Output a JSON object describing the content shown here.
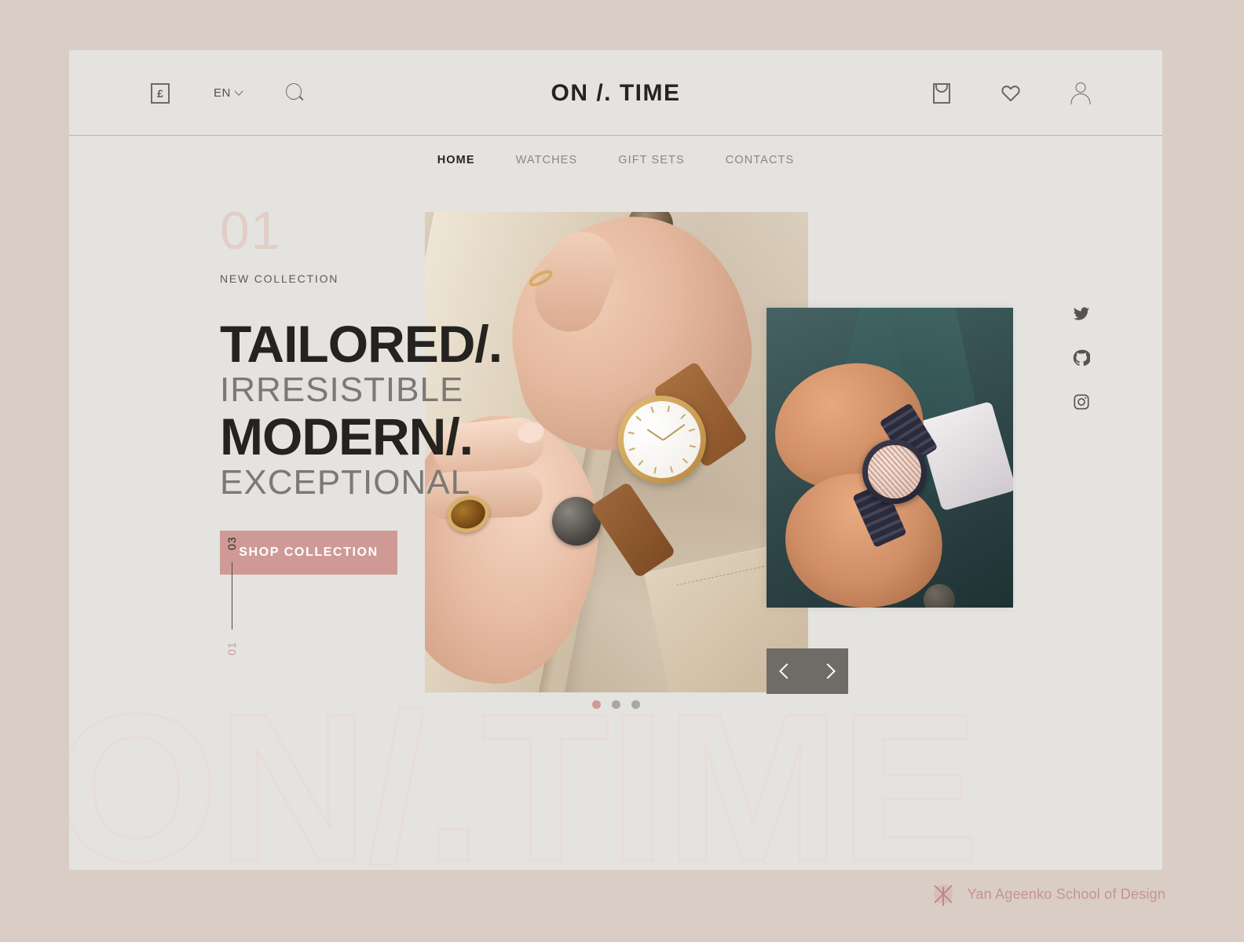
{
  "brand": {
    "name": "ON /. TIME"
  },
  "topbar": {
    "currency_symbol": "£",
    "currency_icon": "pound-box-icon",
    "language": "EN",
    "language_chevron_icon": "chevron-down-icon",
    "search_icon": "search-icon",
    "bag_icon": "shopping-bag-icon",
    "wishlist_icon": "heart-icon",
    "account_icon": "user-icon"
  },
  "nav": {
    "items": [
      {
        "label": "HOME",
        "active": true
      },
      {
        "label": "WATCHES",
        "active": false
      },
      {
        "label": "GIFT SETS",
        "active": false
      },
      {
        "label": "CONTACTS",
        "active": false
      }
    ]
  },
  "hero": {
    "slide_number": "01",
    "eyebrow": "NEW COLLECTION",
    "line1": "TAILORED/.",
    "line2": "IRRESISTIBLE",
    "line3": "MODERN/.",
    "line4": "EXCEPTIONAL",
    "cta": "SHOP COLLECTION",
    "counter_total": "03",
    "counter_current": "01",
    "prev_icon": "chevron-left-icon",
    "next_icon": "chevron-right-icon"
  },
  "carousel": {
    "dots": [
      "01",
      "02",
      "03"
    ],
    "active_index": 0
  },
  "social": {
    "items": [
      {
        "name": "twitter-icon",
        "label": "Twitter"
      },
      {
        "name": "github-icon",
        "label": "GitHub"
      },
      {
        "name": "instagram-icon",
        "label": "Instagram"
      }
    ]
  },
  "watermark": {
    "text": "ON/.TIME"
  },
  "attribution": {
    "text": "Yan Ageenko School of Design",
    "logo_icon": "yan-ageenko-logo-icon"
  },
  "colors": {
    "page_background": "#d9cdc6",
    "panel_background": "#e4e3df",
    "accent_rose": "#cf9a95",
    "text_dark": "#25231f",
    "text_muted": "#7c7974",
    "watermark_stroke": "#e8dcd8",
    "arrow_panel": "#6f6c67"
  }
}
